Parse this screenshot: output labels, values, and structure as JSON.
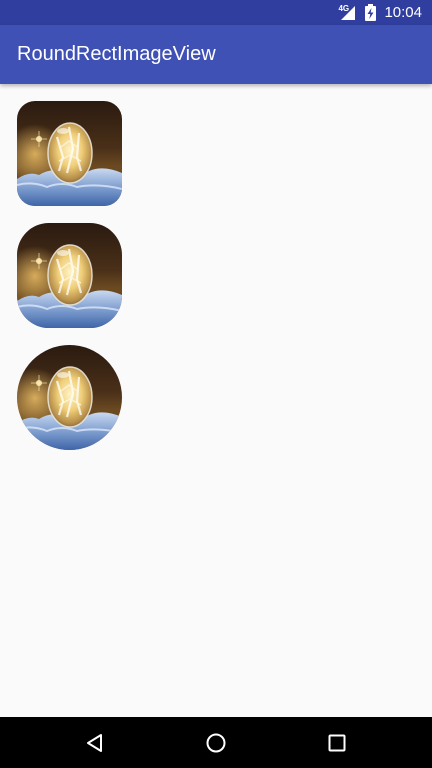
{
  "status_bar": {
    "network_label": "4G",
    "time": "10:04",
    "icons": [
      "signal-icon",
      "battery-charging-icon"
    ]
  },
  "app_bar": {
    "title": "RoundRectImageView"
  },
  "images": [
    {
      "name": "round-rect-image-small-radius",
      "subject": "frozen soap bubble on snow",
      "shape": "rounded rectangle"
    },
    {
      "name": "round-rect-image-large-radius",
      "subject": "frozen soap bubble on snow",
      "shape": "rounded rectangle"
    },
    {
      "name": "circle-image",
      "subject": "frozen soap bubble on snow",
      "shape": "circle"
    }
  ],
  "nav_bar": {
    "buttons": [
      "back-icon",
      "home-icon",
      "recents-icon"
    ]
  },
  "colors": {
    "status_bar": "#303f9f",
    "app_bar": "#3f51b5",
    "background": "#fafafa",
    "nav_bar": "#000000"
  }
}
